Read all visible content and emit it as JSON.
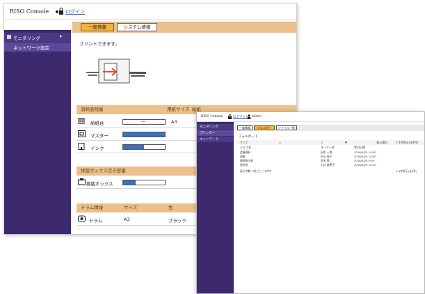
{
  "main": {
    "app_name": "RISO Console",
    "login": "ログイン",
    "sidebar": [
      {
        "label": "モニタリング",
        "arrow": "▸"
      },
      {
        "label": "ネットワーク設定"
      }
    ],
    "tabs": [
      {
        "label": "一般情報",
        "active": true
      },
      {
        "label": "システム情報",
        "active": false
      }
    ],
    "status": "プリントできます。",
    "consumables": {
      "header": [
        "消耗品残量",
        "用紙サイズ",
        "給紙"
      ],
      "rows": [
        {
          "icon": "paper-tray-icon",
          "label": "給紙台",
          "bar_text": "—",
          "paper_size": "A3"
        },
        {
          "icon": "master-icon",
          "label": "マスター",
          "level": 1.0
        },
        {
          "icon": "ink-icon",
          "label": "インク",
          "level": 0.5
        }
      ]
    },
    "waste": {
      "header": "排版ボックス空き容量",
      "rows": [
        {
          "icon": "waste-box-icon",
          "label": "排版ボックス",
          "level": 0.3
        }
      ]
    },
    "drum": {
      "header": [
        "ドラム情報",
        "サイズ",
        "色"
      ],
      "rows": [
        {
          "icon": "drum-icon",
          "label": "ドラム",
          "size": "A3",
          "color": "ブラック"
        }
      ]
    },
    "accent": "#3d2a6e",
    "section_color": "#ecc08a",
    "tab_active_color": "#f2b43d",
    "level_color": "#3a6fc2"
  },
  "overlay": {
    "app_name": "RISO Console",
    "login": "ログアウト",
    "user": "admin",
    "sidebar": [
      "モニタリング",
      "プリンター",
      "ネットワーク"
    ],
    "tabs": [
      "一般情報",
      "フォルダー",
      "ファイル一覧"
    ],
    "folder": "フォルダー 1",
    "toolbar": [
      "すべて",
      "△",
      "▽",
      "▼",
      "表示順位"
    ],
    "columns": [
      "ジョブ名",
      "オーナー名",
      "受付日時"
    ],
    "jobs": [
      {
        "name": "ジョブ名",
        "owner": "オーナー名",
        "date": "受付日時"
      },
      {
        "name": "会議資料",
        "owner": "田中 一郎",
        "date": "2016/4/20 14:00"
      },
      {
        "name": "週報",
        "owner": "杉山 直子",
        "date": "2016/4/20 14:50"
      },
      {
        "name": "業務指示書",
        "owner": "鈴木 薫",
        "date": "2016/4/20 9:50"
      },
      {
        "name": "週計画",
        "owner": "山口 美恵子",
        "date": "2016/4/20 10:30"
      }
    ],
    "footer": "表示件数: 5件ごと / 1件中",
    "page_info": "1-4件表示(全4件)"
  }
}
